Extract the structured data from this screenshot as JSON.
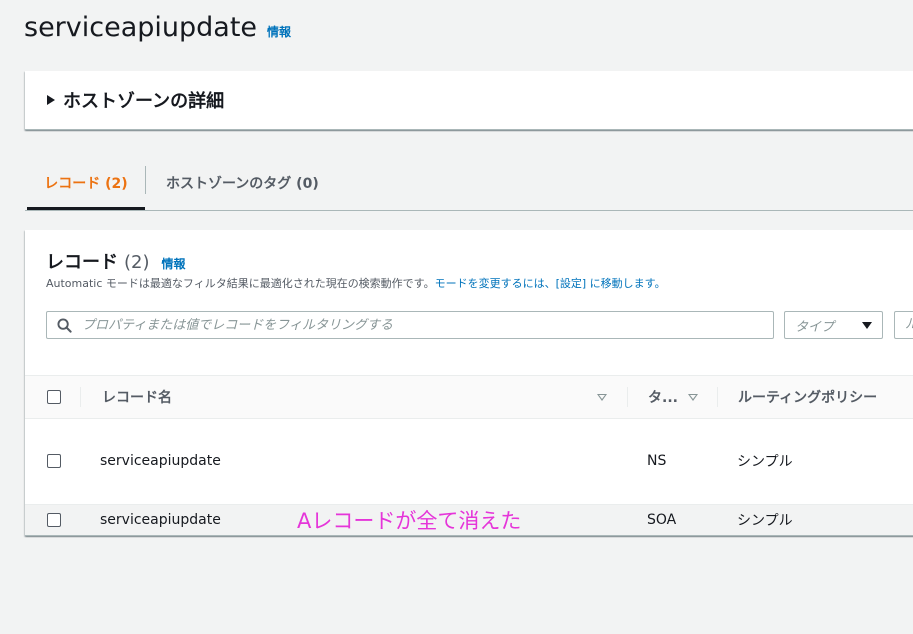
{
  "page": {
    "title": "serviceapiupdate",
    "info_label": "情報"
  },
  "details_panel": {
    "label": "ホストゾーンの詳細"
  },
  "tabs": [
    {
      "label": "レコード (2)"
    },
    {
      "label": "ホストゾーンのタグ (0)"
    }
  ],
  "records": {
    "title": "レコード",
    "count": "(2)",
    "info_label": "情報",
    "description_prefix": "Automatic モードは最適なフィルタ結果に最適化された現在の検索動作です。",
    "description_link": "モードを変更するには、[設定] に移動します。",
    "search_placeholder": "プロパティまたは値でレコードをフィルタリングする",
    "type_select_placeholder": "タイプ",
    "extra_select_placeholder": "ル",
    "columns": {
      "name": "レコード名",
      "type": "タ...",
      "routing": "ルーティングポリシー"
    },
    "rows": [
      {
        "name": "serviceapiupdate",
        "type": "NS",
        "routing": "シンプル"
      },
      {
        "name": "serviceapiupdate",
        "type": "SOA",
        "routing": "シンプル"
      }
    ]
  },
  "annotation": {
    "text": "Aレコードが全て消えた",
    "color": "#e535d9"
  },
  "colors": {
    "accent": "#ec7211",
    "link": "#0073bb"
  }
}
